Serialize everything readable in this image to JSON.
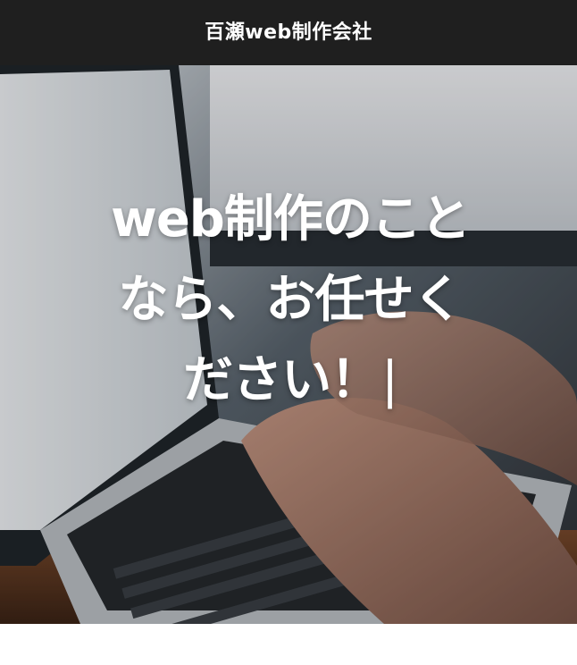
{
  "header": {
    "site_title": "百瀬web制作会社",
    "background_color": "#1f1f1f"
  },
  "hero": {
    "headline": "web制作のことなら、お任せください！",
    "caret": "|",
    "background_image": "laptop-typing-photo",
    "text_color": "#ffffff"
  }
}
